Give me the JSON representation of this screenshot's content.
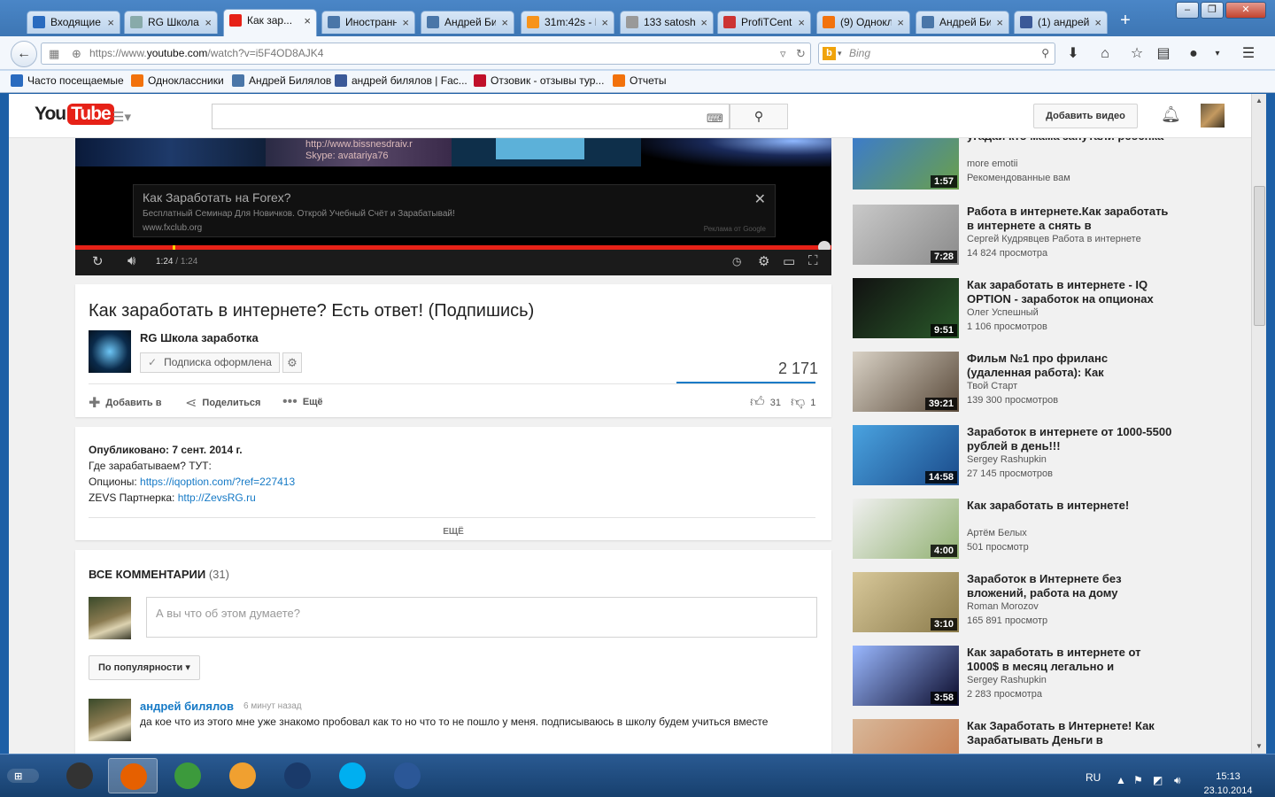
{
  "browser": {
    "tabs": [
      {
        "label": "Входящие ...",
        "icon": "mail-icon",
        "color": "#2a6bbf"
      },
      {
        "label": "RG Школа ...",
        "icon": "page-icon",
        "color": "#8aa"
      },
      {
        "label": "Как зар...",
        "icon": "youtube-icon",
        "color": "#e62117"
      },
      {
        "label": "Иностранн...",
        "icon": "vk-icon",
        "color": "#4a76a8"
      },
      {
        "label": "Андрей Би...",
        "icon": "vk-icon",
        "color": "#4a76a8"
      },
      {
        "label": "31m:42s - F...",
        "icon": "bitcoin-icon",
        "color": "#f7931a"
      },
      {
        "label": "133 satoshi ...",
        "icon": "coin-icon",
        "color": "#999"
      },
      {
        "label": "ProfiTCent...",
        "icon": "chart-icon",
        "color": "#c33"
      },
      {
        "label": "(9) Однокл...",
        "icon": "odnoklassniki-icon",
        "color": "#f2720c"
      },
      {
        "label": "Андрей Би...",
        "icon": "vk-icon",
        "color": "#4a76a8"
      },
      {
        "label": "(1) андрей ...",
        "icon": "facebook-icon",
        "color": "#3b5998"
      }
    ],
    "url_prefix": "https://www.",
    "url_host": "youtube.com",
    "url_path": "/watch?v=i5F4OD8AJK4",
    "search_engine": "Bing",
    "bookmarks": [
      {
        "label": "Часто посещаемые",
        "icon": "firefox-icon",
        "color": "#2a6bbf"
      },
      {
        "label": "Одноклассники",
        "icon": "odnoklassniki-icon",
        "color": "#f2720c"
      },
      {
        "label": "Андрей Билялов",
        "icon": "vk-icon",
        "color": "#4a76a8"
      },
      {
        "label": "андрей билялов | Fac...",
        "icon": "facebook-icon",
        "color": "#3b5998"
      },
      {
        "label": "Отзовик - отзывы тур...",
        "icon": "otzovik-icon",
        "color": "#c0102a"
      },
      {
        "label": "Отчеты",
        "icon": "refresh-icon",
        "color": "#f2720c"
      }
    ]
  },
  "youtube": {
    "logo_you": "You",
    "logo_tube": "Tube",
    "upload_label": "Добавить видео",
    "player": {
      "overlay_url": "http://www.bissnesdraiv.r",
      "overlay_skype": "Skype: avatariya76",
      "ad_title": "Как Заработать на Forex?",
      "ad_text": "Бесплатный Семинар Для Новичков. Открой Учебный Счёт и Зарабатывай!",
      "ad_url": "www.fxclub.org",
      "ad_source": "Реклама от Google",
      "time_current": "1:24",
      "time_total": "1:24",
      "progress": 1.0
    },
    "video": {
      "title": "Как заработать в интернете? Есть ответ! (Подпишись)",
      "channel": "RG Школа заработка",
      "subscribed_label": "Подписка оформлена",
      "views": "2 171",
      "add_to": "Добавить в",
      "share": "Поделиться",
      "more": "Ещё",
      "likes": "31",
      "dislikes": "1"
    },
    "description": {
      "published": "Опубликовано: 7 сент. 2014 г.",
      "line1": "Где зарабатываем? ТУТ:",
      "line2_label": "Опционы: ",
      "line2_link": "https://iqoption.com/?ref=227413",
      "line3_label": "ZEVS Партнерка: ",
      "line3_link": "http://ZevsRG.ru",
      "show_more": "ЕЩЁ"
    },
    "comments": {
      "heading": "ВСЕ КОММЕНТАРИИ",
      "count": "(31)",
      "placeholder": "А вы что об этом думаете?",
      "sort_label": "По популярности",
      "first": {
        "author": "андрей билялов",
        "time": "6 минут назад",
        "text": " да кое что из этого мне уже знакомо  пробовал как то но что то не пошло у меня. подписываюсь в школу  будем учиться вместе"
      }
    },
    "related": [
      {
        "title": "угадай кто мама запутали ребенка",
        "channel": "more emotii",
        "views": "Рекомендованные вам",
        "duration": "1:57",
        "thumb": [
          "#3a7ad0",
          "#6aa04a"
        ]
      },
      {
        "title": "Работа в интернете.Как заработать в интернете а снять в",
        "channel": "Сергей Кудрявцев Работа в интернете",
        "views": "14 824 просмотра",
        "duration": "7:28",
        "thumb": [
          "#c9c9c9",
          "#8a8a8a"
        ]
      },
      {
        "title": "Как заработать в интернете - IQ OPTION - заработок на опционах",
        "channel": "Олег Успешный",
        "views": "1 106 просмотров",
        "duration": "9:51",
        "thumb": [
          "#111111",
          "#2a5a2a"
        ]
      },
      {
        "title": "Фильм №1 про фриланс (удаленная работа): Как",
        "channel": "Твой Старт",
        "views": "139 300 просмотров",
        "duration": "39:21",
        "thumb": [
          "#d9d2c6",
          "#5a4a3a"
        ]
      },
      {
        "title": "Заработок в интернете от 1000-5500 рублей в день!!!",
        "channel": "Sergey Rashupkin",
        "views": "27 145 просмотров",
        "duration": "14:58",
        "thumb": [
          "#4aa3e0",
          "#1a4a8a"
        ]
      },
      {
        "title": "Как заработать в интернете!",
        "channel": "Артём Белых",
        "views": "501 просмотр",
        "duration": "4:00",
        "thumb": [
          "#f0f0f0",
          "#90b070"
        ]
      },
      {
        "title": "Заработок в Интернете без вложений, работа на дому",
        "channel": "Roman Morozov",
        "views": "165 891 просмотр",
        "duration": "3:10",
        "thumb": [
          "#d8c89a",
          "#8a7a4a"
        ]
      },
      {
        "title": "Как заработать в интернете от 1000$ в месяц легально и",
        "channel": "Sergey Rashupkin",
        "views": "2 283 просмотра",
        "duration": "3:58",
        "thumb": [
          "#9ab8ff",
          "#0a0a2a"
        ]
      },
      {
        "title": "Как Заработать в Интернете! Как Зарабатывать Деньги в",
        "channel": "",
        "views": "",
        "duration": "",
        "thumb": [
          "#d8b89a",
          "#c4784a"
        ]
      }
    ]
  },
  "taskbar": {
    "apps": [
      {
        "name": "taskbar-app-explorer",
        "color": "#333333"
      },
      {
        "name": "taskbar-app-firefox",
        "color": "#e66000"
      },
      {
        "name": "taskbar-app-chrome",
        "color": "#3c9a3c"
      },
      {
        "name": "taskbar-app-eye",
        "color": "#f0a030"
      },
      {
        "name": "taskbar-app-media",
        "color": "#1a3a6a"
      },
      {
        "name": "taskbar-app-skype",
        "color": "#00aff0"
      },
      {
        "name": "taskbar-app-word",
        "color": "#2b5797"
      }
    ],
    "lang": "RU",
    "time": "15:13",
    "date": "23.10.2014"
  }
}
